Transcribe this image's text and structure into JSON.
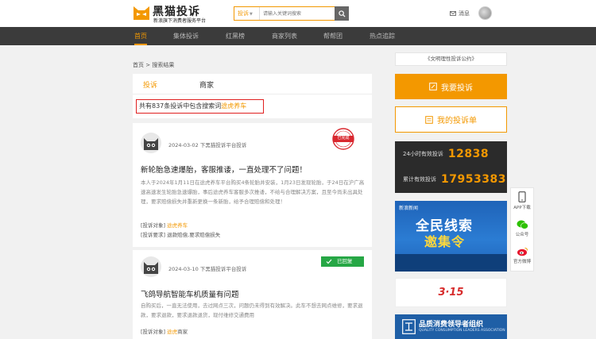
{
  "brand": {
    "title": "黑猫投诉",
    "subtitle": "新浪旗下消费者服务平台"
  },
  "search": {
    "type_label": "投诉",
    "placeholder": "请输入关键词搜索"
  },
  "header": {
    "messages_label": "消息"
  },
  "nav": {
    "items": [
      "首页",
      "集体投诉",
      "红黑榜",
      "商家列表",
      "帮帮团",
      "热点追踪"
    ]
  },
  "breadcrumb": {
    "home": "首页",
    "separator": ">",
    "current": "搜索结果"
  },
  "tabs": [
    "投诉",
    "商家"
  ],
  "summary": {
    "prefix": "共有837条投诉中包含搜索词",
    "keyword": "途虎养车"
  },
  "complaints": [
    {
      "date": "2024-03-02",
      "source": "下黑猫投诉平台投诉",
      "status": "已完成",
      "title": "新轮胎急速爆胎，客服推诿，一直处理不了问题！",
      "body": "本人于2024年1月11日在途虎养车平台购买4条轮胎并安装，1月23日发现轮胎，于24日在沪广高速高速发生轮胎急速爆胎，事后途虎养车客服多次推诿，不给与合理解决方案，且至今尚未出具处理，要求赔偿损失并重新更换一条新胎，给予合理赔偿和处理！",
      "target_label": "[投诉对象]",
      "target": "途虎养车",
      "demand_label": "[投诉要求]",
      "demand": "退款赔偿,要求赔偿损失"
    },
    {
      "date": "2024-03-10",
      "source": "下黑猫投诉平台投诉",
      "status": "已回复",
      "title": "飞鸽导航智能车机质量有问题",
      "body": "自购买后，一直无法使用，去过网点三次，问题仍未得到有效解决。此车不想去网点维修，要求退款，要求退款，要求退款退货，现付维修交通费用",
      "target_label": "[投诉对象]",
      "target": "途虎",
      "target_suffix": "商家"
    }
  ],
  "sidebar": {
    "notice": "《文明理性投诉公约》",
    "complain_button": "我要投诉",
    "my_complaints_button": "我的投诉单",
    "stats": [
      {
        "label": "24小时有效投诉",
        "value": "12838"
      },
      {
        "label": "累计有效投诉",
        "value": "17953383"
      }
    ],
    "promo": {
      "brand": "新浪新闻",
      "line1": "全民线索",
      "line2": "邀集令"
    },
    "ad_315": "3·15",
    "org": {
      "title": "品质消费领导者组织",
      "subtitle": "QUALITY CONSUMPTION LEADERS ASSOCIATION"
    }
  },
  "float_bar": [
    "APP下载",
    "公众号",
    "官方微博"
  ],
  "colors": {
    "accent": "#f39800",
    "nav_bg": "#3b3b3b",
    "success": "#26a745",
    "highlight_border": "#e02020",
    "promo_blue": "#1f63b8"
  }
}
